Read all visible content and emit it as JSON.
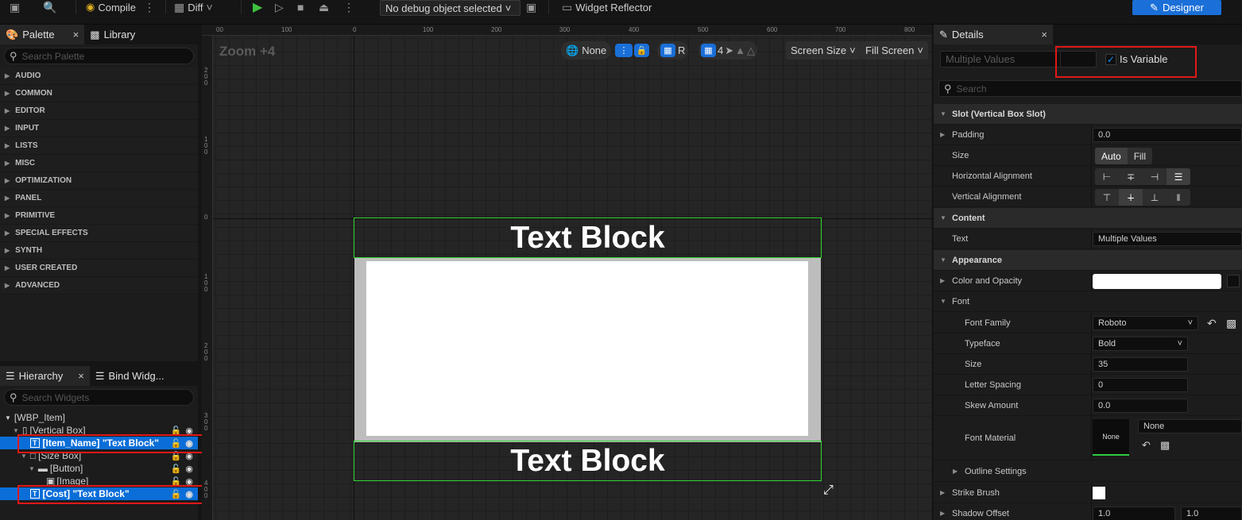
{
  "toolbar": {
    "compile_label": "Compile",
    "diff_label": "Diff",
    "debug_select": "No debug object selected",
    "widget_reflector": "Widget Reflector",
    "designer_label": "Designer"
  },
  "palette": {
    "tab_label": "Palette",
    "library_label": "Library",
    "search_placeholder": "Search Palette",
    "categories": [
      "AUDIO",
      "COMMON",
      "EDITOR",
      "INPUT",
      "LISTS",
      "MISC",
      "OPTIMIZATION",
      "PANEL",
      "PRIMITIVE",
      "SPECIAL EFFECTS",
      "SYNTH",
      "USER CREATED",
      "ADVANCED"
    ]
  },
  "hierarchy": {
    "tab_label": "Hierarchy",
    "bind_label": "Bind Widg...",
    "search_placeholder": "Search Widgets",
    "items": [
      {
        "label": "[WBP_Item]"
      },
      {
        "label": "[Vertical Box]"
      },
      {
        "label": "[Item_Name] \"Text Block\"",
        "selected": true
      },
      {
        "label": "[Size Box]"
      },
      {
        "label": "[Button]"
      },
      {
        "label": "[Image]"
      },
      {
        "label": "[Cost] \"Text Block\"",
        "selected": true
      }
    ]
  },
  "canvas": {
    "zoom": "Zoom +4",
    "none_label": "None",
    "r_label": "R",
    "grid_value": "4",
    "screen_size": "Screen Size",
    "fill_screen": "Fill Screen",
    "text_block_top": "Text Block",
    "text_block_bottom": "Text Block",
    "ruler_top": [
      "00",
      "100",
      "0",
      "100",
      "200",
      "300",
      "400",
      "500",
      "600",
      "700",
      "800"
    ],
    "ruler_left": [
      "200",
      "100",
      "0",
      "100",
      "200",
      "300",
      "400"
    ]
  },
  "details": {
    "tab_label": "Details",
    "name_placeholder": "Multiple Values",
    "is_variable": "Is Variable",
    "search_placeholder": "Search",
    "slot_section": "Slot (Vertical Box Slot)",
    "padding_label": "Padding",
    "padding_value": "0.0",
    "size_label": "Size",
    "size_auto": "Auto",
    "size_fill": "Fill",
    "h_align_label": "Horizontal Alignment",
    "v_align_label": "Vertical Alignment",
    "content_section": "Content",
    "text_label": "Text",
    "text_value": "Multiple Values",
    "appearance_section": "Appearance",
    "color_label": "Color and Opacity",
    "font_label": "Font",
    "font_family_label": "Font Family",
    "font_family_value": "Roboto",
    "typeface_label": "Typeface",
    "typeface_value": "Bold",
    "size2_label": "Size",
    "size2_value": "35",
    "letter_spacing_label": "Letter Spacing",
    "letter_spacing_value": "0",
    "skew_label": "Skew Amount",
    "skew_value": "0.0",
    "font_material_label": "Font Material",
    "font_material_thumb": "None",
    "font_material_value": "None",
    "outline_label": "Outline Settings",
    "strike_label": "Strike Brush",
    "shadow_label": "Shadow Offset",
    "shadow_x": "1.0",
    "shadow_y": "1.0"
  },
  "colors": {
    "accent": "#1a6fd8",
    "selection": "#0b6ed8",
    "highlight_box": "#e01818",
    "widget_outline": "#2ed82e"
  }
}
